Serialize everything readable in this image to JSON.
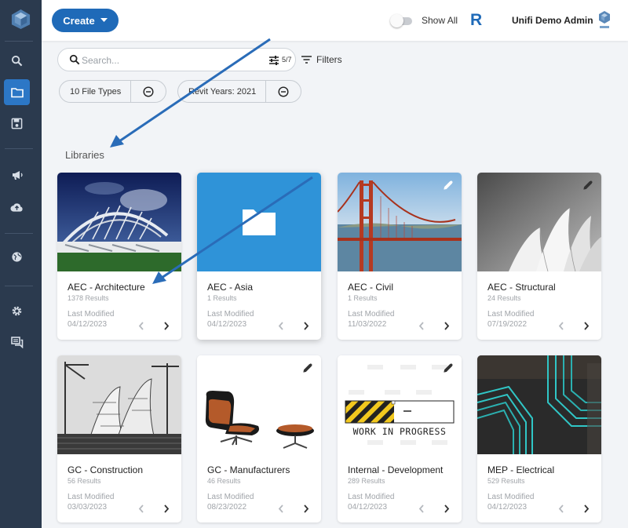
{
  "topbar": {
    "create_label": "Create",
    "show_all_label": "Show All",
    "user_name": "Unifi Demo Admin",
    "revit_icon_letter": "R"
  },
  "sidebar": {
    "items": [
      {
        "icon": "search-icon"
      },
      {
        "icon": "folder-icon",
        "active": true
      },
      {
        "icon": "save-icon"
      },
      {
        "icon": "megaphone-icon"
      },
      {
        "icon": "cloud-upload-icon"
      },
      {
        "icon": "globe-icon"
      },
      {
        "icon": "gear-icon"
      },
      {
        "icon": "chat-icon"
      }
    ]
  },
  "search": {
    "placeholder": "Search...",
    "filter_count": "5/7",
    "filters_label": "Filters"
  },
  "chips": [
    {
      "label": "10 File Types"
    },
    {
      "label": "Revit Years: 2021"
    }
  ],
  "section_title": "Libraries",
  "cards": [
    {
      "title": "AEC - Architecture",
      "results": "1378 Results",
      "last_modified_label": "Last Modified",
      "date": "04/12/2023"
    },
    {
      "title": "AEC - Asia",
      "results": "1 Results",
      "last_modified_label": "Last Modified",
      "date": "04/12/2023"
    },
    {
      "title": "AEC - Civil",
      "results": "1 Results",
      "last_modified_label": "Last Modified",
      "date": "11/03/2022"
    },
    {
      "title": "AEC - Structural",
      "results": "24 Results",
      "last_modified_label": "Last Modified",
      "date": "07/19/2022"
    },
    {
      "title": "GC - Construction",
      "results": "56 Results",
      "last_modified_label": "Last Modified",
      "date": "03/03/2023"
    },
    {
      "title": "GC - Manufacturers",
      "results": "46 Results",
      "last_modified_label": "Last Modified",
      "date": "08/23/2022"
    },
    {
      "title": "Internal - Development",
      "results": "289 Results",
      "last_modified_label": "Last Modified",
      "date": "04/12/2023",
      "wip_text": "WORK IN PROGRESS"
    },
    {
      "title": "MEP - Electrical",
      "results": "529 Results",
      "last_modified_label": "Last Modified",
      "date": "04/12/2023"
    }
  ],
  "colors": {
    "accent": "#1f6ab8",
    "sidebar_bg": "#2b3a4e",
    "sidebar_active": "#2c77c6",
    "page_bg": "#f2f4f7"
  }
}
